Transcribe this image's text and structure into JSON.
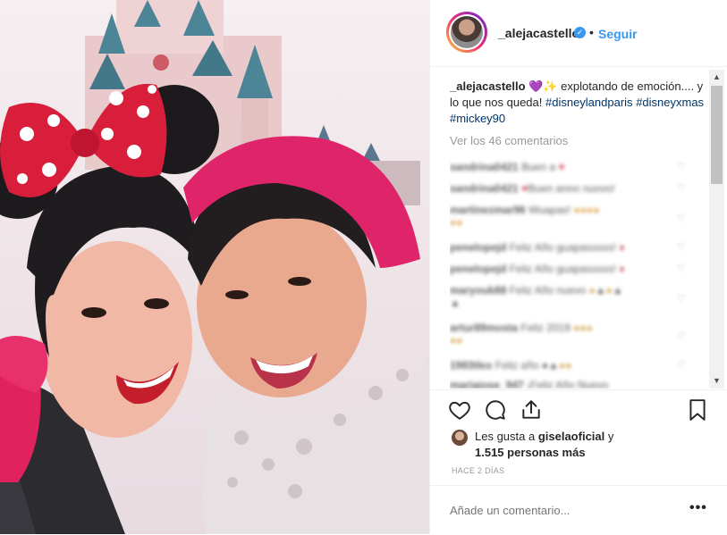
{
  "header": {
    "username": "_alejacastello",
    "verified_symbol": "✓",
    "separator": "•",
    "follow_label": "Seguir"
  },
  "caption": {
    "username": "_alejacastello",
    "emojis": "💜✨",
    "text": " explotando de emoción.... y lo que nos queda! ",
    "hashtags": [
      "#disneylandparis",
      "#disneyxmas",
      "#mickey90"
    ]
  },
  "view_all_comments": "Ver los 46 comentarios",
  "comments": [
    {
      "user": "sandrina0421",
      "text": "Buen a"
    },
    {
      "user": "sandrina0421",
      "text": "Buen anno nuovo!"
    },
    {
      "user": "martinezmar96",
      "text": "Wuapas!"
    },
    {
      "user": "penelopejd",
      "text": "Feliz Año guapasssss!"
    },
    {
      "user": "penelopejd",
      "text": "Feliz Año guapasssss!"
    },
    {
      "user": "maryouk88",
      "text": "Feliz Año nuevo"
    },
    {
      "user": "artur89mosta",
      "text": "Feliz 2019"
    },
    {
      "user": "1983tlex",
      "text": "Feliz año"
    },
    {
      "user": "mariaiose_947",
      "text": "¡Feliz Año Nuevo"
    }
  ],
  "likes": {
    "prefix": "Les gusta a ",
    "user": "giselaoficial",
    "suffix": " y",
    "others": "1.515 personas más"
  },
  "timestamp": "HACE 2 DÍAS",
  "comment_input": {
    "placeholder": "Añade un comentario..."
  },
  "more_label": "•••",
  "scrollbar": {
    "up": "▲",
    "down": "▼"
  },
  "icons": [
    "heart-icon",
    "comment-icon",
    "share-icon",
    "bookmark-icon",
    "verified-icon"
  ],
  "colors": {
    "link": "#3897f0",
    "hashtag": "#003569",
    "muted": "#999999",
    "text": "#262626"
  }
}
